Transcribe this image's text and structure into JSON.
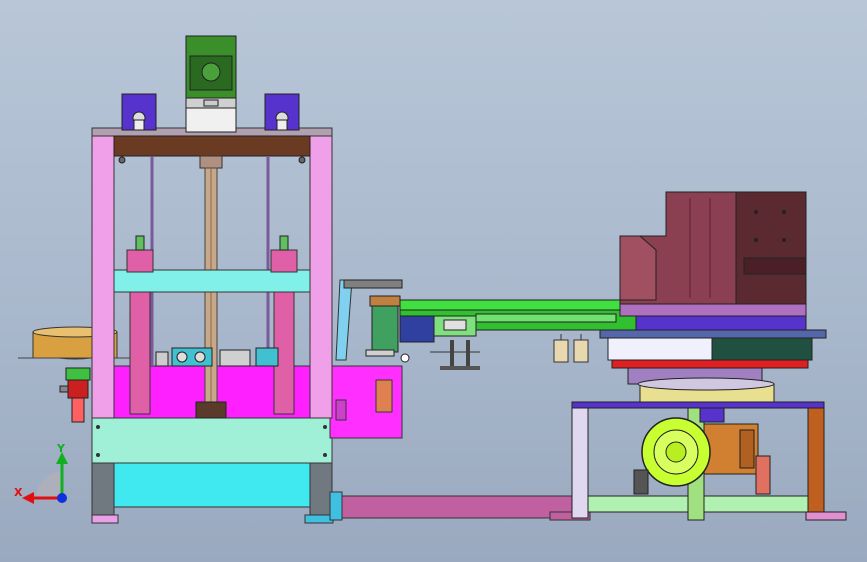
{
  "app": {
    "title": ""
  },
  "triad": {
    "x_label": "X",
    "y_label": "Y",
    "x_color": "#e01010",
    "y_color": "#10b020",
    "z_color": "#1030e0"
  },
  "colors": {
    "background": "#a9b8cc",
    "frame_pink": "#f0a0e0",
    "cylinder_pink": "#e060a8",
    "base_cyan": "#60f0f0",
    "magenta_panel": "#ff20ff",
    "brown_beam": "#6b3a22",
    "green_motor": "#3a8f2a",
    "purple_block": "#5533cc",
    "maroon_housing": "#8a4050",
    "lime_motor": "#c8ff30",
    "conveyor_green": "#40e040"
  },
  "components": [
    {
      "name": "top-motor",
      "icon": "motor-icon"
    },
    {
      "name": "left-sensor-block",
      "icon": "bracket-icon"
    },
    {
      "name": "right-sensor-block",
      "icon": "bracket-icon"
    },
    {
      "name": "press-frame",
      "icon": "frame-icon"
    },
    {
      "name": "center-lead-screw",
      "icon": "screw-icon"
    },
    {
      "name": "left-cylinder",
      "icon": "cylinder-icon"
    },
    {
      "name": "right-cylinder",
      "icon": "cylinder-icon"
    },
    {
      "name": "conveyor-arm",
      "icon": "conveyor-icon"
    },
    {
      "name": "rotary-table",
      "icon": "table-icon"
    },
    {
      "name": "drive-motor",
      "icon": "motor-icon"
    },
    {
      "name": "support-stand",
      "icon": "stand-icon"
    }
  ]
}
